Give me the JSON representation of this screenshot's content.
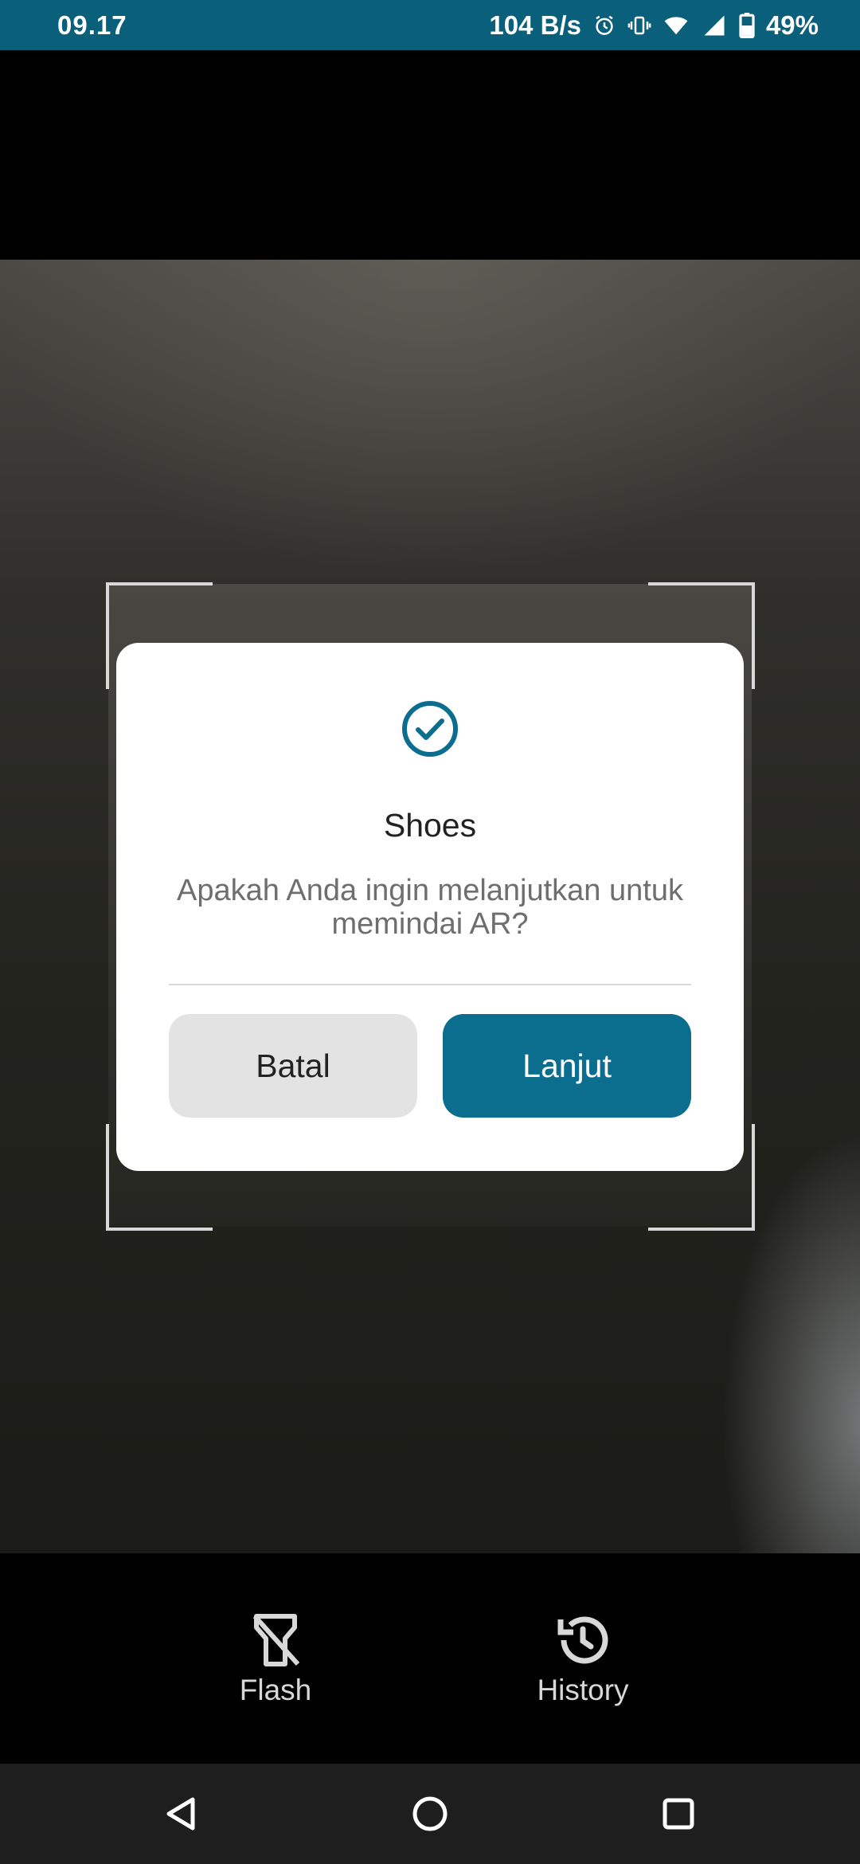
{
  "status_bar": {
    "time": "09.17",
    "network_speed": "104 B/s",
    "battery": "49%",
    "icons": [
      "alarm-icon",
      "vibrate-icon",
      "wifi-icon",
      "signal-icon",
      "battery-icon"
    ]
  },
  "dialog": {
    "icon": "check-circle-icon",
    "title": "Shoes",
    "message": "Apakah Anda ingin melanjutkan untuk memindai AR?",
    "cancel_label": "Batal",
    "continue_label": "Lanjut"
  },
  "toolbar": {
    "flash_label": "Flash",
    "flash_icon": "flash-off-icon",
    "history_label": "History",
    "history_icon": "history-icon"
  },
  "nav": {
    "back_icon": "back-icon",
    "home_icon": "home-icon",
    "recents_icon": "recents-icon"
  },
  "colors": {
    "accent": "#0b6e8e",
    "status_bar": "#0a5f7a",
    "cancel_bg": "#e3e3e3"
  }
}
